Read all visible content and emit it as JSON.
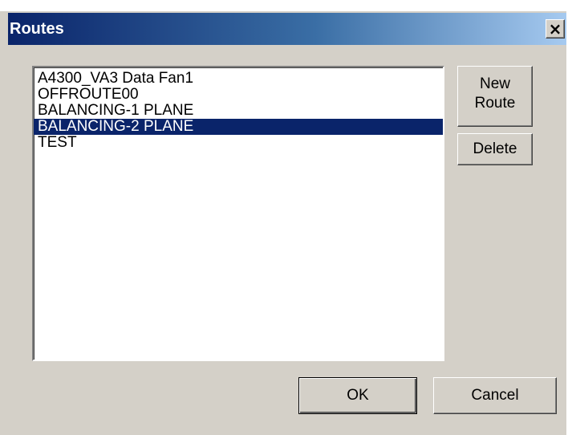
{
  "window": {
    "title": "Routes",
    "close_glyph": "×"
  },
  "routes_list": {
    "items": [
      {
        "label": "A4300_VA3 Data Fan1",
        "selected": false
      },
      {
        "label": "OFFROUTE00",
        "selected": false
      },
      {
        "label": "BALANCING-1 PLANE",
        "selected": false
      },
      {
        "label": "BALANCING-2 PLANE",
        "selected": true
      },
      {
        "label": "TEST",
        "selected": false
      }
    ]
  },
  "buttons": {
    "new_route_line1": "New",
    "new_route_line2": "Route",
    "delete": "Delete",
    "ok": "OK",
    "cancel": "Cancel"
  },
  "colors": {
    "selection": "#0a246a",
    "dialog_face": "#d4d0c8"
  }
}
